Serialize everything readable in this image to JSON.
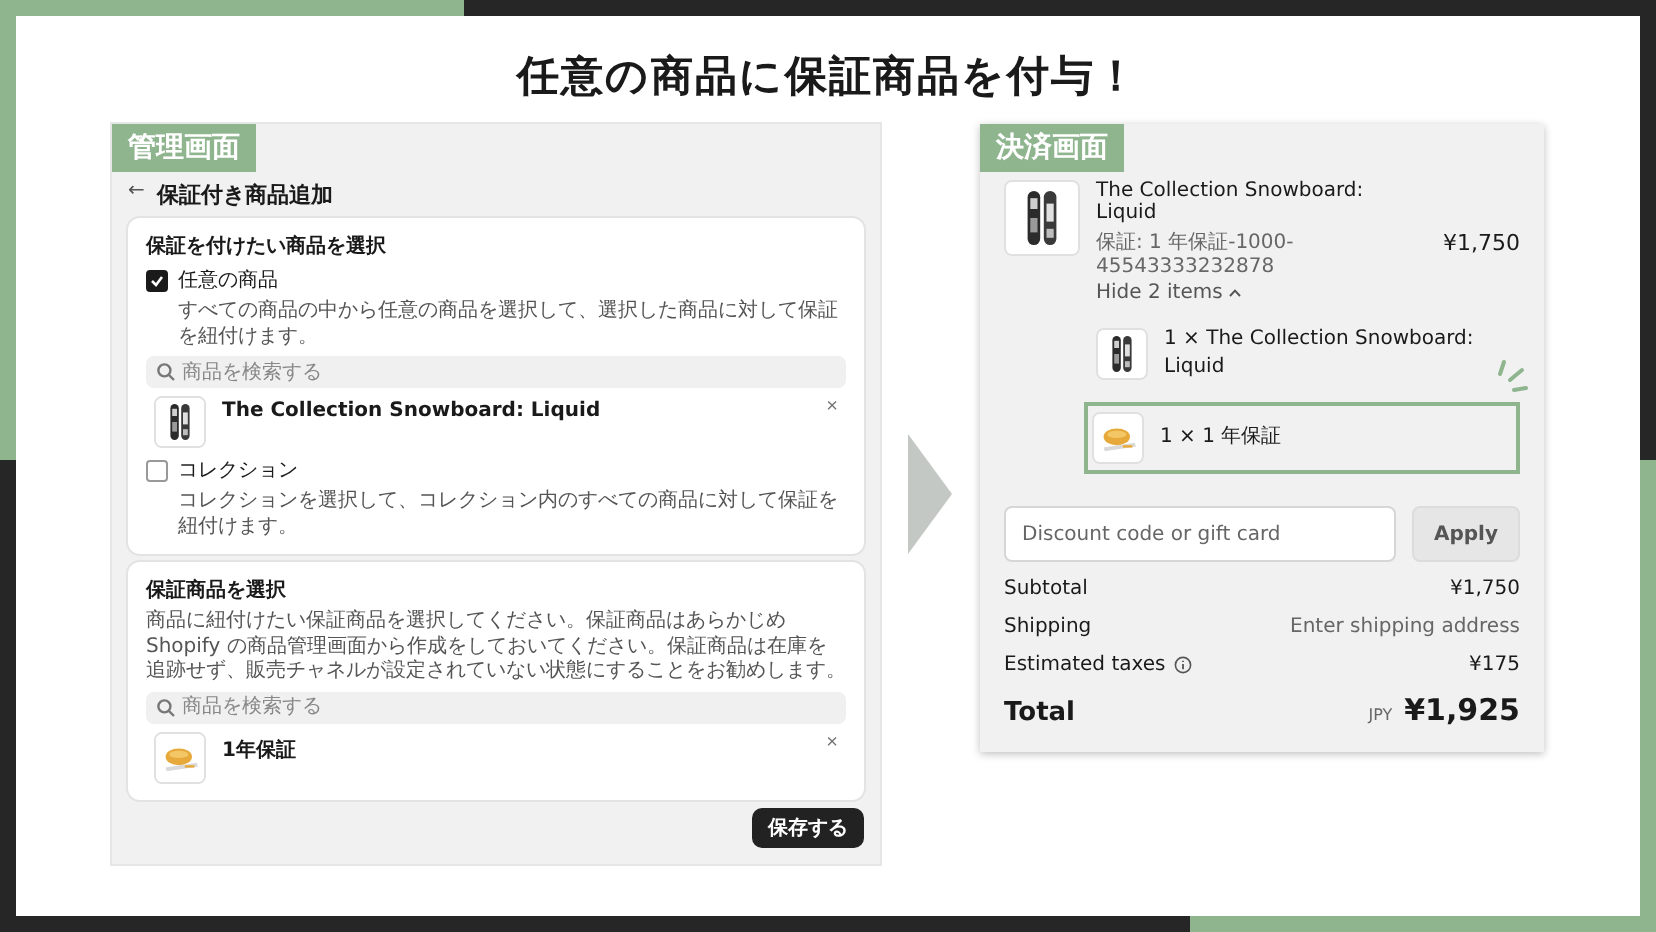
{
  "title": "任意の商品に保証商品を付与！",
  "admin": {
    "badge": "管理画面",
    "back": "←",
    "header": "保証付き商品追加",
    "target_card": {
      "title": "保証を付けたい商品を選択",
      "options": [
        {
          "label": "任意の商品",
          "checked": true,
          "description": "すべての商品の中から任意の商品を選択して、選択した商品に対して保証を紐付けます。",
          "search_placeholder": "商品を検索する",
          "products": [
            {
              "name": "The Collection Snowboard: Liquid",
              "kind": "snowboard",
              "remove": "×"
            }
          ]
        },
        {
          "label": "コレクション",
          "checked": false,
          "description": "コレクションを選択して、コレクション内のすべての商品に対して保証を紐付けます。"
        }
      ]
    },
    "warranty_card": {
      "title": "保証商品を選択",
      "description": "商品に紐付けたい保証商品を選択してください。保証商品はあらかじめ Shopify の商品管理画面から作成をしておいてください。保証商品は在庫を追跡せず、販売チャネルが設定されていない状態にすることをお勧めします。",
      "search_placeholder": "商品を検索する",
      "products": [
        {
          "name": "1年保証",
          "kind": "warranty",
          "remove": "×"
        }
      ]
    },
    "save_button": "保存する"
  },
  "checkout": {
    "badge": "決済画面",
    "product": {
      "name": "The Collection Snowboard: Liquid",
      "kind": "snowboard",
      "variant": "保証: 1 年保証-1000-45543333232878",
      "toggle": "Hide 2 items",
      "price": "¥1,750"
    },
    "bundle_items": [
      {
        "label": "1 × The Collection Snowboard: Liquid",
        "kind": "snowboard",
        "highlighted": false
      },
      {
        "label": "1 × 1 年保証",
        "kind": "warranty",
        "highlighted": true
      }
    ],
    "discount": {
      "placeholder": "Discount code or gift card",
      "button": "Apply"
    },
    "summary": [
      {
        "label": "Subtotal",
        "value": "¥1,750",
        "kind": "amount",
        "info": false
      },
      {
        "label": "Shipping",
        "value": "Enter shipping address",
        "kind": "note",
        "info": false
      },
      {
        "label": "Estimated taxes",
        "value": "¥175",
        "kind": "amount",
        "info": true
      }
    ],
    "total": {
      "label": "Total",
      "currency": "JPY",
      "value": "¥1,925"
    }
  }
}
